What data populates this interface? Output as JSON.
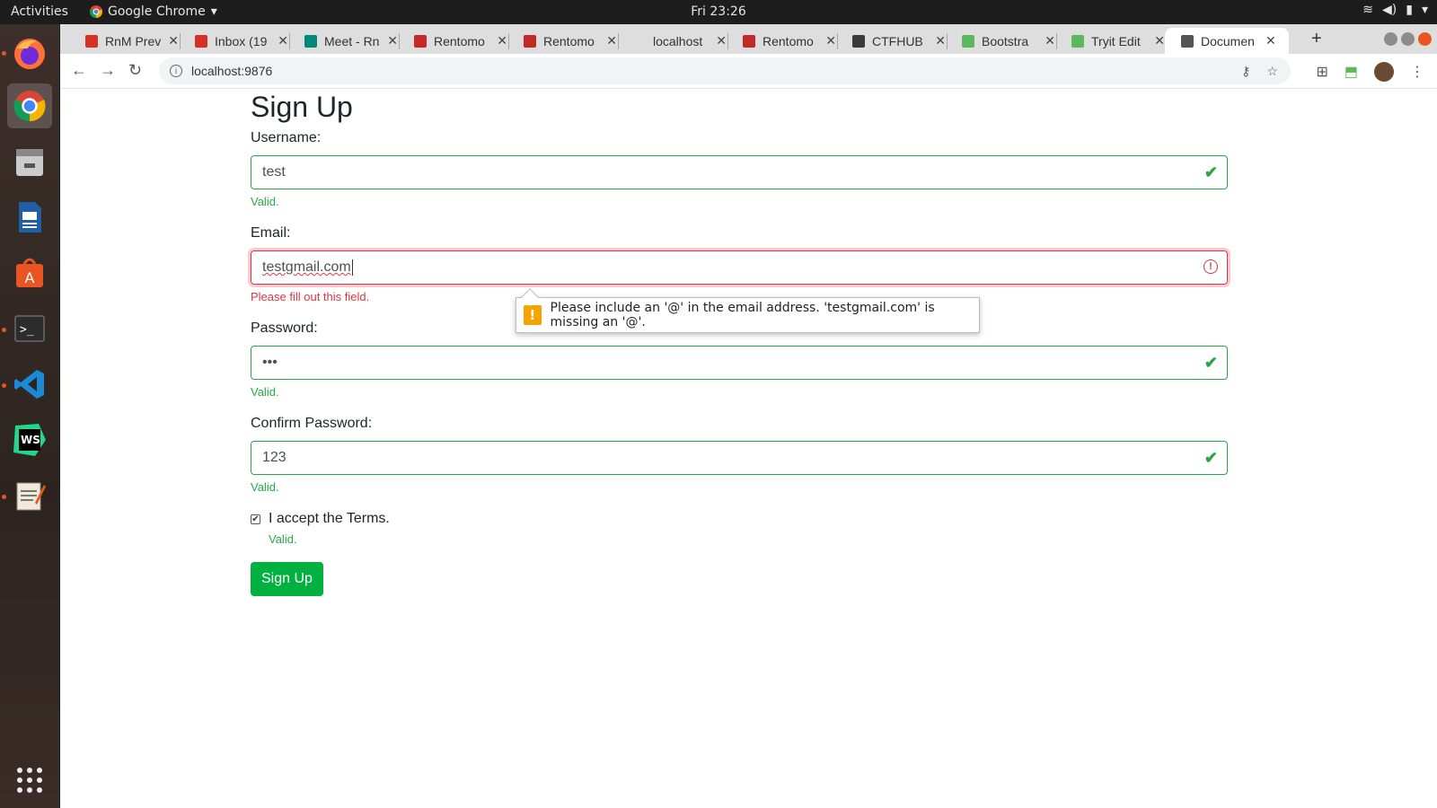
{
  "os": {
    "activities": "Activities",
    "app_name": "Google Chrome",
    "clock": "Fri 23:26"
  },
  "browser": {
    "tabs": [
      {
        "title": "RnM Prev",
        "color": "#d93025"
      },
      {
        "title": "Inbox (19",
        "color": "#d93025"
      },
      {
        "title": "Meet - Rn",
        "color": "#00897b"
      },
      {
        "title": "Rentomo",
        "color": "#c62828"
      },
      {
        "title": "Rentomo",
        "color": "#c62828"
      },
      {
        "title": "localhost",
        "color": "#dedede"
      },
      {
        "title": "Rentomo",
        "color": "#c62828"
      },
      {
        "title": "CTFHUB",
        "color": "#3a3a3a"
      },
      {
        "title": "Bootstra",
        "color": "#5cb85c"
      },
      {
        "title": "Tryit Edit",
        "color": "#5cb85c"
      },
      {
        "title": "Documen",
        "color": "#555555"
      }
    ],
    "url": "localhost:9876"
  },
  "form": {
    "title": "Sign Up",
    "username_label": "Username:",
    "username_value": "test",
    "username_feedback": "Valid.",
    "email_label": "Email:",
    "email_value": "testgmail.com",
    "email_feedback": "Please fill out this field.",
    "email_tooltip": "Please include an '@' in the email address. 'testgmail.com' is missing an '@'.",
    "password_label": "Password:",
    "password_value": "•••",
    "password_feedback": "Valid.",
    "confirm_label": "Confirm Password:",
    "confirm_value": "123",
    "confirm_feedback": "Valid.",
    "terms_label": "I accept the Terms.",
    "terms_checked": true,
    "terms_feedback": "Valid.",
    "submit_label": "Sign Up"
  },
  "colors": {
    "valid": "#28a745",
    "invalid": "#dc3545",
    "submit": "#00b140"
  }
}
